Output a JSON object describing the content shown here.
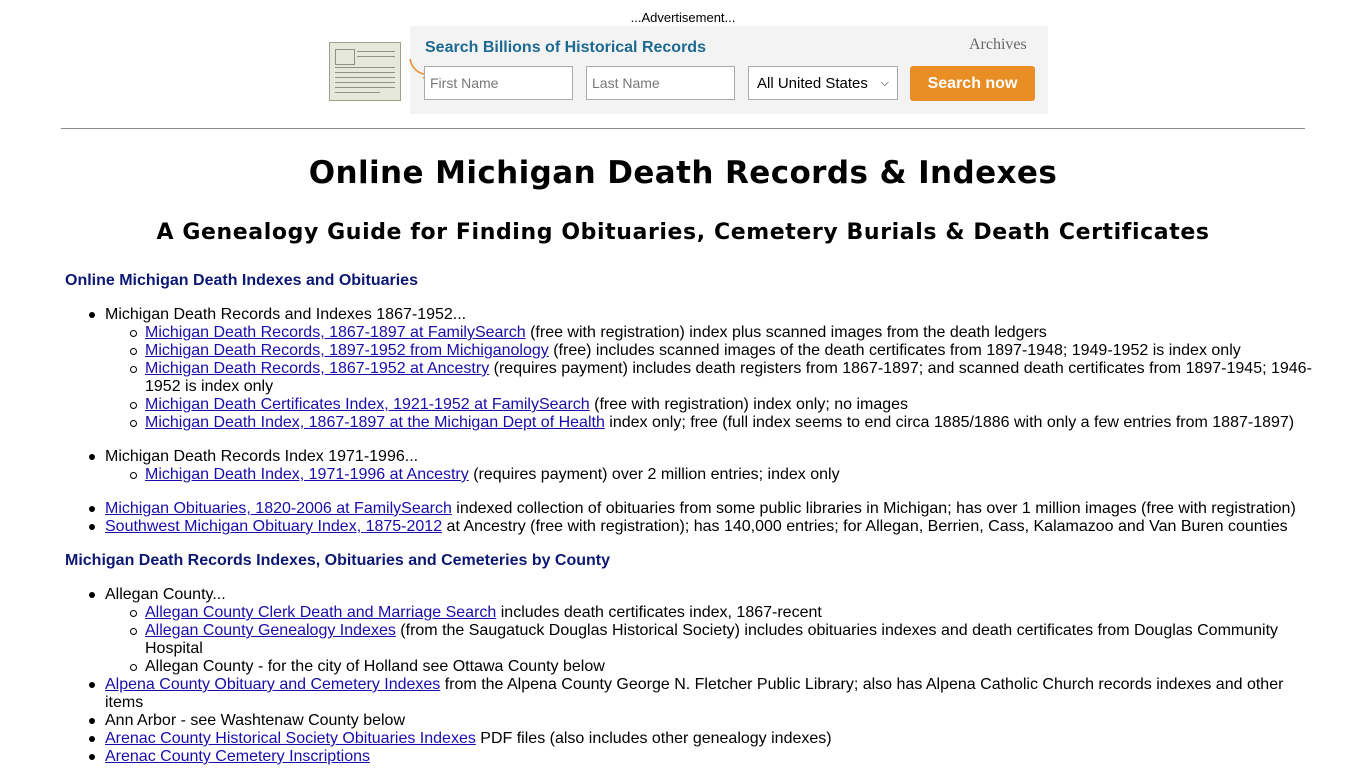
{
  "ad": {
    "label": "...Advertisement...",
    "title": "Search Billions of Historical Records",
    "brand": "Archives",
    "first_name_placeholder": "First Name",
    "last_name_placeholder": "Last Name",
    "region": "All United States",
    "button": "Search now",
    "colors": {
      "title": "#1c6a8f",
      "button": "#e88e24"
    }
  },
  "page": {
    "title": "Online Michigan Death Records & Indexes",
    "subtitle": "A Genealogy Guide for Finding Obituaries, Cemetery Burials & Death Certificates"
  },
  "section1": {
    "heading": "Online Michigan Death Indexes and Obituaries",
    "group1": {
      "label": "Michigan Death Records and Indexes 1867-1952...",
      "items": [
        {
          "link": "Michigan Death Records, 1867-1897 at FamilySearch",
          "text": " (free with registration) index plus scanned images from the death ledgers"
        },
        {
          "link": "Michigan Death Records, 1897-1952 from Michiganology",
          "text": " (free) includes scanned images of the death certificates from 1897-1948; 1949-1952 is index only"
        },
        {
          "link": "Michigan Death Records, 1867-1952 at Ancestry",
          "text": " (requires payment) includes death registers from 1867-1897; and scanned death certificates from 1897-1945; 1946-1952 is index only"
        },
        {
          "link": "Michigan Death Certificates Index, 1921-1952 at FamilySearch",
          "text": " (free with registration) index only; no images"
        },
        {
          "link": "Michigan Death Index, 1867-1897 at the Michigan Dept of Health",
          "text": " index only; free (full index seems to end circa 1885/1886 with only a few entries from 1887-1897)"
        }
      ]
    },
    "group2": {
      "label": "Michigan Death Records Index 1971-1996...",
      "items": [
        {
          "link": "Michigan Death Index, 1971-1996 at Ancestry",
          "text": " (requires payment) over 2 million entries; index only"
        }
      ]
    },
    "extra": [
      {
        "link": "Michigan Obituaries, 1820-2006 at FamilySearch",
        "text": " indexed collection of obituaries from some public libraries in Michigan; has over 1 million images (free with registration)"
      },
      {
        "link": "Southwest Michigan Obituary Index, 1875-2012",
        "text": " at Ancestry (free with registration); has 140,000 entries; for Allegan, Berrien, Cass, Kalamazoo and Van Buren counties"
      }
    ]
  },
  "section2": {
    "heading": "Michigan Death Records Indexes, Obituaries and Cemeteries by County",
    "allegan": {
      "label": "Allegan County...",
      "items": [
        {
          "link": "Allegan County Clerk Death and Marriage Search",
          "text": " includes death certificates index, 1867-recent"
        },
        {
          "link": "Allegan County Genealogy Indexes",
          "text": " (from the Saugatuck Douglas Historical Society) includes obituaries indexes and death certificates from Douglas Community Hospital"
        },
        {
          "link": "",
          "text": "Allegan County - for the city of Holland see Ottawa County below"
        }
      ]
    },
    "others": [
      {
        "link": "Alpena County Obituary and Cemetery Indexes",
        "text": " from the Alpena County George N. Fletcher Public Library; also has Alpena Catholic Church records indexes and other items"
      },
      {
        "link": "",
        "text": "Ann Arbor - see Washtenaw County below"
      },
      {
        "link": "Arenac County Historical Society Obituaries Indexes",
        "text": " PDF files (also includes other genealogy indexes)"
      },
      {
        "link": "Arenac County Cemetery Inscriptions",
        "text": ""
      }
    ]
  }
}
